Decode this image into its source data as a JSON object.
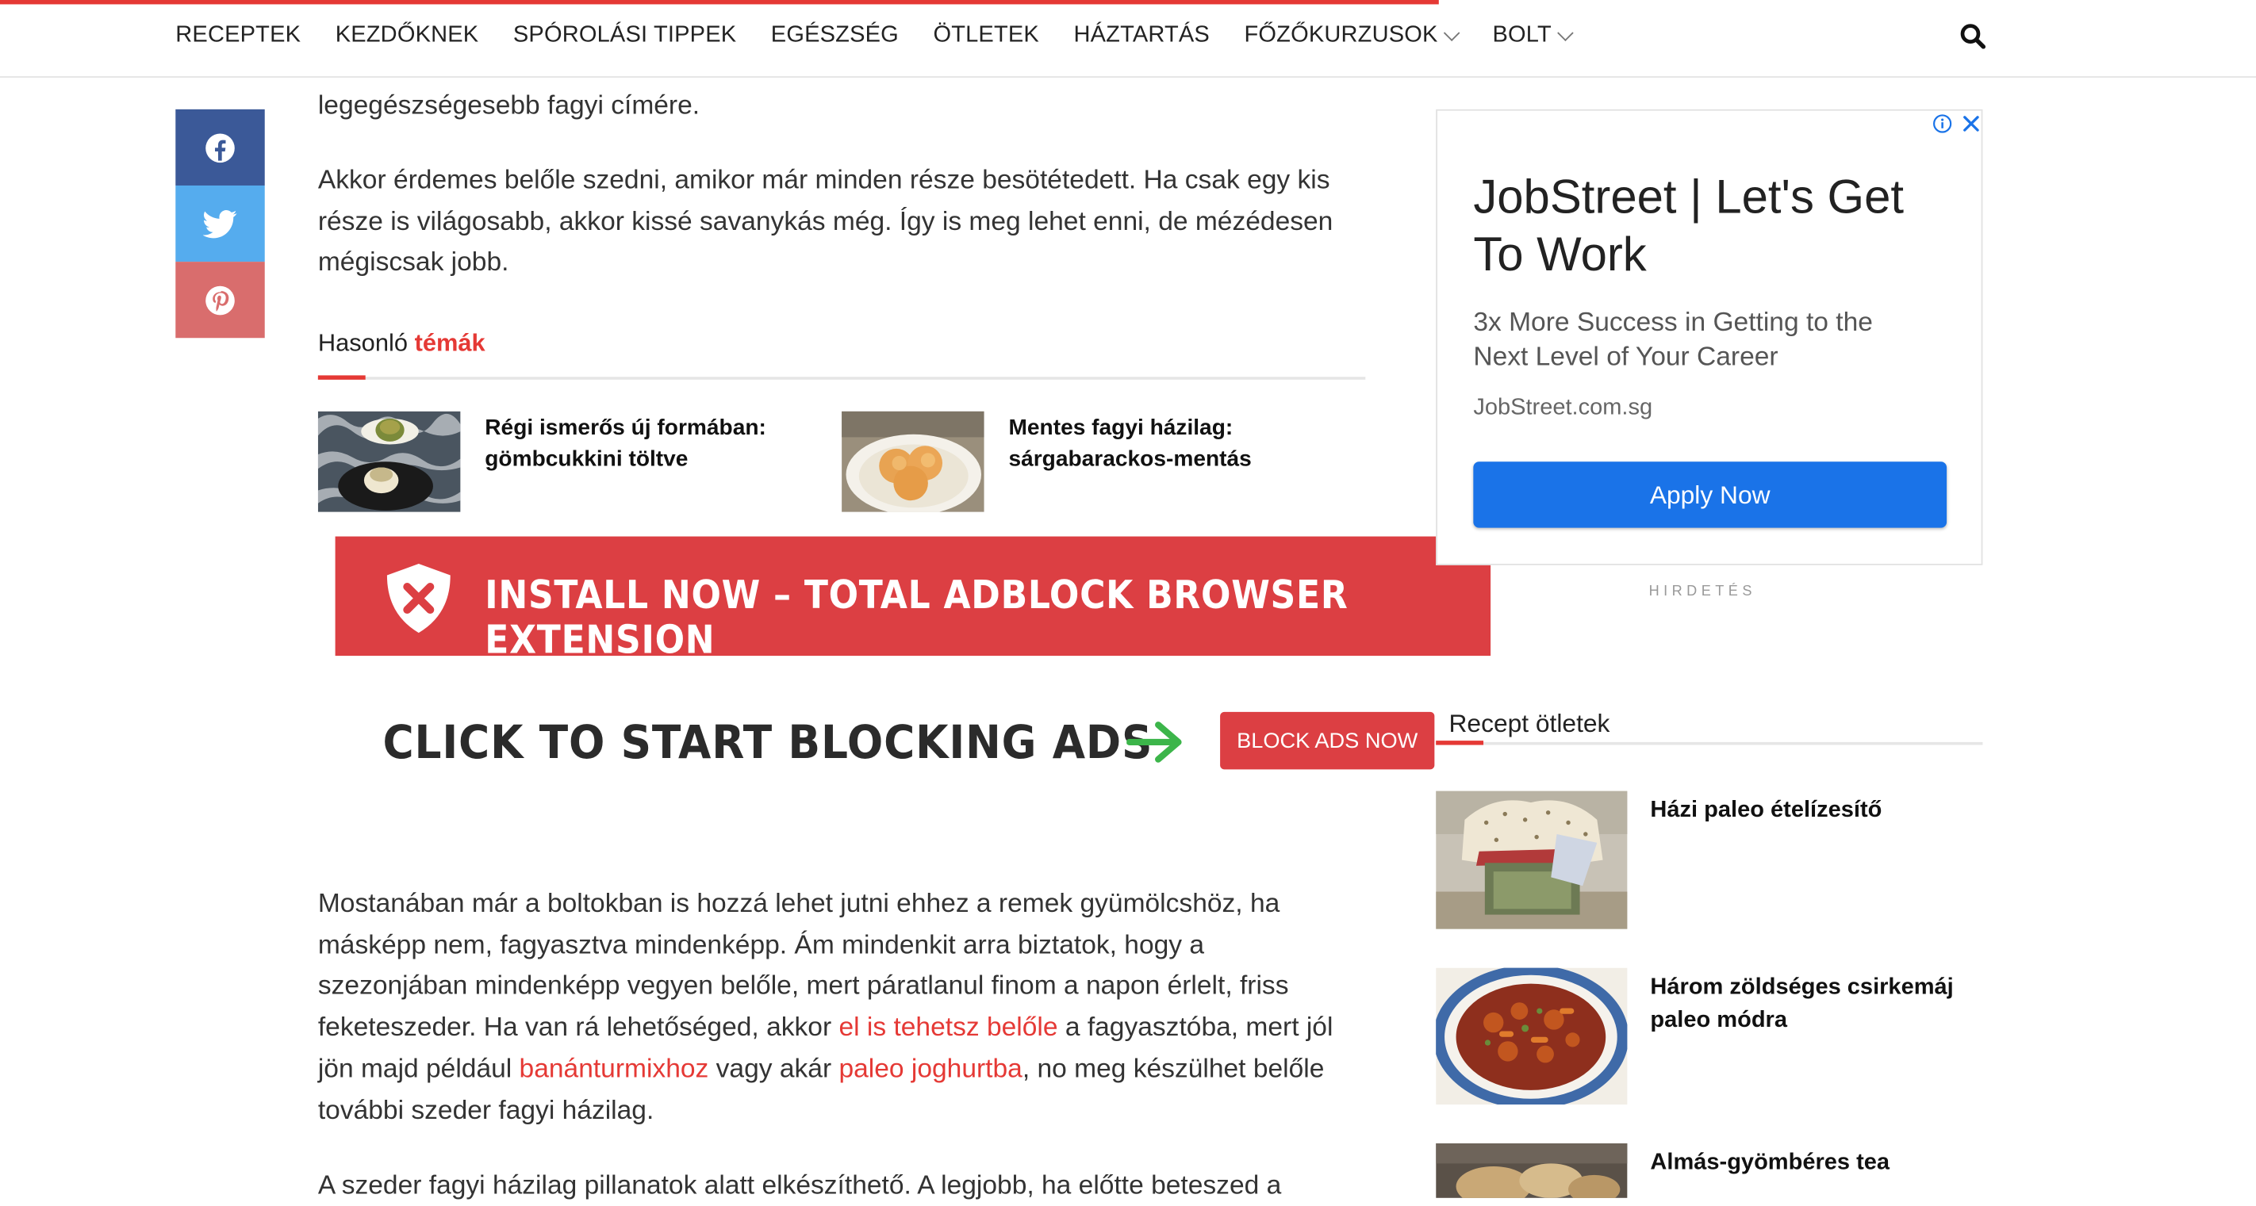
{
  "nav": {
    "items": [
      {
        "label": "RECEPTEK",
        "dropdown": false
      },
      {
        "label": "KEZDŐKNEK",
        "dropdown": false
      },
      {
        "label": "SPÓROLÁSI TIPPEK",
        "dropdown": false
      },
      {
        "label": "EGÉSZSÉG",
        "dropdown": false
      },
      {
        "label": "ÖTLETEK",
        "dropdown": false
      },
      {
        "label": "HÁZTARTÁS",
        "dropdown": false
      },
      {
        "label": "FŐZŐKURZUSOK",
        "dropdown": true
      },
      {
        "label": "BOLT",
        "dropdown": true
      }
    ],
    "search_icon": "search-icon",
    "accent_color": "#e53935"
  },
  "share": {
    "facebook_icon": "facebook-icon",
    "facebook_color": "#3b5998",
    "twitter_icon": "twitter-icon",
    "twitter_color": "#55acee",
    "pinterest_icon": "pinterest-icon",
    "pinterest_color": "#cb2027"
  },
  "article": {
    "para1_tail": "legegészségesebb fagyi címére.",
    "para2": "Akkor érdemes belőle szedni, amikor már minden része besötétedett. Ha csak egy kis része is világosabb, akkor kissé savanykás még. Így is meg lehet enni, de mézédesen mégiscsak jobb.",
    "para3": {
      "t1": "Mostanában már a boltokban is hozzá lehet jutni ehhez a remek gyümölcshöz, ha másképp nem, fagyasztva mindenképp. Ám mindenkit arra biztatok, hogy a szezonjában mindenképp vegyen belőle, mert páratlanul finom a napon érlelt, friss feketeszeder. Ha van rá lehetőséged, akkor ",
      "link1": "el is tehetsz belőle",
      "t2": " a fagyasztóba, mert jól jön majd például ",
      "link2": "banánturmixhoz",
      "t3": " vagy akár ",
      "link3": "paleo joghurtba",
      "t4": ", no meg készülhet belőle további szeder fagyi házilag."
    },
    "para4_head": "A szeder fagyi házilag pillanatok alatt elkészíthető. A legjobb, ha előtte beteszed a"
  },
  "related": {
    "title_plain": "Hasonló",
    "title_accent": "témák",
    "items": [
      {
        "title": "Régi ismerős új formában: gömbcukkini töltve"
      },
      {
        "title": "Mentes fagyi házilag: sárgabarackos-mentás"
      }
    ]
  },
  "adblock": {
    "banner_text": "INSTALL NOW – TOTAL ADBLOCK BROWSER EXTENSION",
    "click_text": "CLICK TO START BLOCKING ADS",
    "button_label": "BLOCK ADS NOW",
    "shield_icon": "shield-x-icon",
    "arrow_icon": "arrow-right-icon",
    "banner_color": "#dc3f43",
    "arrow_color": "#3cb54a"
  },
  "ad": {
    "title": "JobStreet | Let's Get To Work",
    "subtitle": "3x More Success in Getting to the Next Level of Your Career",
    "url": "JobStreet.com.sg",
    "button_label": "Apply Now",
    "button_color": "#1a73e8",
    "label": "HIRDETÉS"
  },
  "sidebar": {
    "title": "Recept ötletek",
    "items": [
      {
        "title": "Házi paleo ételízesítő"
      },
      {
        "title": "Három zöldséges csirkemáj paleo módra"
      },
      {
        "title": "Almás-gyömbéres tea"
      }
    ]
  }
}
